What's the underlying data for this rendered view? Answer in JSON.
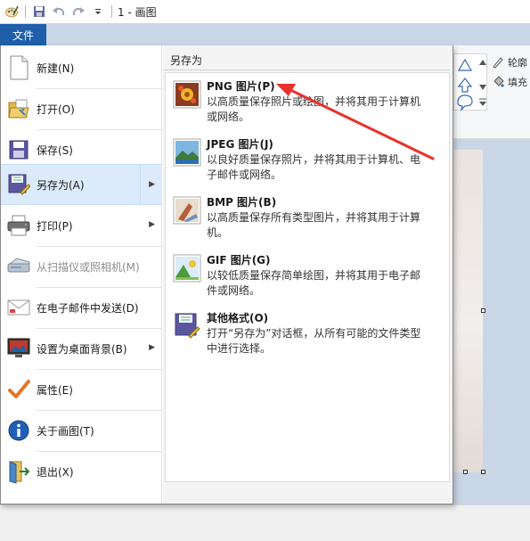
{
  "window": {
    "title": "1 - 画图"
  },
  "quick_access": [
    "paint-app-icon",
    "save-icon",
    "undo-icon",
    "redo-icon",
    "customize-dropdown-icon"
  ],
  "file_tab": {
    "label": "文件"
  },
  "menu": {
    "items": [
      {
        "label": "新建(N)",
        "icon": "new-document-icon",
        "submenu": false,
        "disabled": false
      },
      {
        "label": "打开(O)",
        "icon": "open-folder-icon",
        "submenu": false,
        "disabled": false
      },
      {
        "label": "保存(S)",
        "icon": "save-icon",
        "submenu": false,
        "disabled": false
      },
      {
        "label": "另存为(A)",
        "icon": "save-as-icon",
        "submenu": true,
        "disabled": false,
        "active": true
      },
      {
        "label": "打印(P)",
        "icon": "printer-icon",
        "submenu": true,
        "disabled": false
      },
      {
        "label": "从扫描仪或照相机(M)",
        "icon": "scanner-icon",
        "submenu": false,
        "disabled": true
      },
      {
        "label": "在电子邮件中发送(D)",
        "icon": "email-icon",
        "submenu": false,
        "disabled": false
      },
      {
        "label": "设置为桌面背景(B)",
        "icon": "desktop-background-icon",
        "submenu": true,
        "disabled": false
      },
      {
        "label": "属性(E)",
        "icon": "properties-checkmark-icon",
        "submenu": false,
        "disabled": false
      },
      {
        "label": "关于画图(T)",
        "icon": "info-icon",
        "submenu": false,
        "disabled": false
      },
      {
        "label": "退出(X)",
        "icon": "exit-icon",
        "submenu": false,
        "disabled": false
      }
    ]
  },
  "save_as_panel": {
    "heading": "另存为",
    "options": [
      {
        "title": "PNG 图片(P)",
        "desc": "以高质量保存照片或绘图，并将其用于计算机或网络。",
        "icon": "png-image-icon"
      },
      {
        "title": "JPEG 图片(J)",
        "desc": "以良好质量保存照片，并将其用于计算机、电子邮件或网络。",
        "icon": "jpeg-image-icon"
      },
      {
        "title": "BMP 图片(B)",
        "desc": "以高质量保存所有类型图片，并将其用于计算机。",
        "icon": "bmp-image-icon"
      },
      {
        "title": "GIF 图片(G)",
        "desc": "以较低质量保存简单绘图，并将其用于电子邮件或网络。",
        "icon": "gif-image-icon"
      },
      {
        "title": "其他格式(O)",
        "desc": "打开“另存为”对话框，从所有可能的文件类型中进行选择。",
        "icon": "other-formats-icon"
      }
    ]
  },
  "ribbon": {
    "outline_label": "轮廓",
    "fill_label": "填充"
  },
  "colors": {
    "file_tab": "#1f5ea9",
    "active_item": "#dcebfb",
    "annotation_arrow": "#e8322a",
    "workspace": "#c9d6e6"
  }
}
